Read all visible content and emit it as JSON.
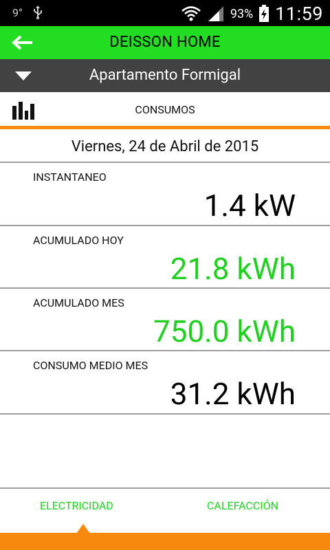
{
  "status_bar": {
    "left_indicator": "9°",
    "usb_icon": "usb-icon",
    "wifi_icon": "wifi-icon",
    "signal_icon": "signal-icon",
    "battery_percent": "93%",
    "battery_icon": "battery-charging-icon",
    "time": "11:59"
  },
  "app_bar": {
    "title": "DEISSON HOME",
    "back_icon": "arrow-left-icon",
    "color": "#22dd22"
  },
  "location_bar": {
    "title": "Apartamento Formigal",
    "dropdown_icon": "triangle-down-icon",
    "color": "#424242"
  },
  "section": {
    "title": "CONSUMOS",
    "icon": "bar-chart-icon",
    "accent_color": "#f7890f"
  },
  "date": "Viernes, 24 de Abril de 2015",
  "metrics": [
    {
      "label": "INSTANTANEO",
      "value": "1.4 kW",
      "color": "#000000"
    },
    {
      "label": "ACUMULADO HOY",
      "value": "21.8 kWh",
      "color": "#21cf21"
    },
    {
      "label": "ACUMULADO MES",
      "value": "750.0 kWh",
      "color": "#21cf21"
    },
    {
      "label": "CONSUMO MEDIO MES",
      "value": "31.2 kWh",
      "color": "#000000"
    }
  ],
  "tabs": [
    {
      "label": "ELECTRICIDAD",
      "selected": true
    },
    {
      "label": "CALEFACCIÓN",
      "selected": false
    }
  ]
}
